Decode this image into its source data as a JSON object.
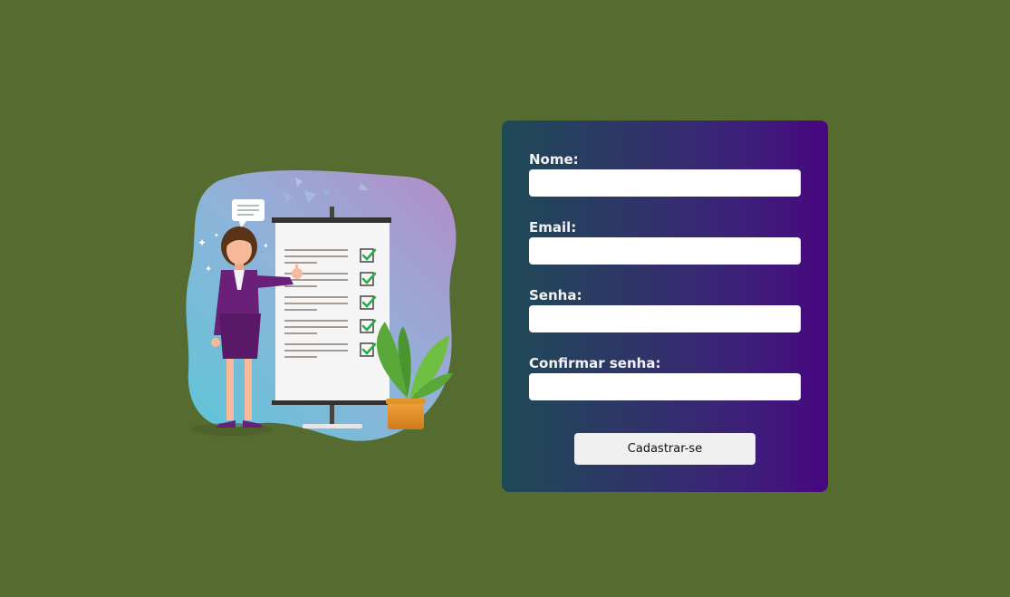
{
  "form": {
    "fields": [
      {
        "label": "Nome:",
        "value": "",
        "placeholder": ""
      },
      {
        "label": "Email:",
        "value": "",
        "placeholder": ""
      },
      {
        "label": "Senha:",
        "value": "",
        "placeholder": ""
      },
      {
        "label": "Confirmar senha:",
        "value": "",
        "placeholder": ""
      }
    ],
    "submit_label": "Cadastrar-se"
  },
  "colors": {
    "page_background": "#566b30",
    "card_gradient_start": "#1e4a55",
    "card_gradient_end": "#48067f",
    "input_background": "#ffffff",
    "button_background": "#efefef"
  }
}
